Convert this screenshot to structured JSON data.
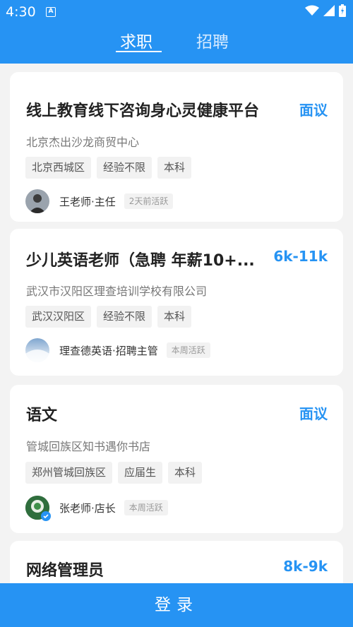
{
  "status_bar": {
    "time": "4:30",
    "notification_badge": "A"
  },
  "tabs": {
    "active": "求职",
    "inactive": "招聘"
  },
  "jobs": [
    {
      "title": "线上教育线下咨询身心灵健康平台",
      "salary": "面议",
      "company": "北京杰出沙龙商贸中心",
      "tags": [
        "北京西城区",
        "经验不限",
        "本科"
      ],
      "recruiter": "王老师·主任",
      "active": "2天前活跃"
    },
    {
      "title": "少儿英语老师（急聘 年薪10+...",
      "salary": "6k-11k",
      "company": "武汉市汉阳区理查培训学校有限公司",
      "tags": [
        "武汉汉阳区",
        "经验不限",
        "本科"
      ],
      "recruiter": "理查德英语·招聘主管",
      "active": "本周活跃"
    },
    {
      "title": "语文",
      "salary": "面议",
      "company": "管城回族区知书遇你书店",
      "tags": [
        "郑州管城回族区",
        "应届生",
        "本科"
      ],
      "recruiter": "张老师·店长",
      "active": "本周活跃"
    },
    {
      "title": "网络管理员",
      "salary": "8k-9k"
    }
  ],
  "login": "登录",
  "colors": {
    "primary": "#2693f3",
    "card": "#ffffff",
    "background": "#f3f3f3"
  }
}
